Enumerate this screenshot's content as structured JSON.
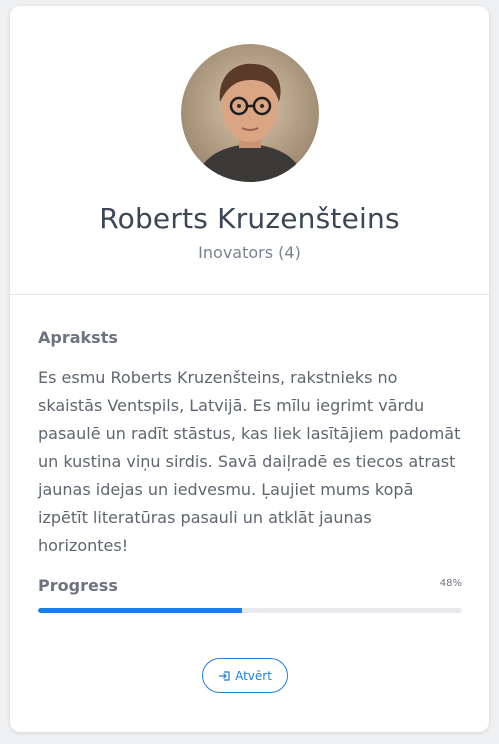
{
  "profile": {
    "name": "Roberts Kruzenšteins",
    "subtitle": "Inovators (4)",
    "avatar_icon": "person-photo"
  },
  "description": {
    "title": "Apraksts",
    "text": "Es esmu Roberts Kruzenšteins, rakstnieks no skaistās Ventspils, Latvijā. Es mīlu iegrimt vārdu pasaulē un radīt stāstus, kas liek lasītājiem padomāt un kustina viņu sirdis. Savā daiļradē es tiecos atrast jaunas idejas un iedvesmu. Ļaujiet mums kopā izpētīt literatūras pasauli un atklāt jaunas horizontes!"
  },
  "progress": {
    "title": "Progress",
    "value_label": "48%",
    "value": 0.48
  },
  "actions": {
    "open_label": "Atvērt",
    "open_icon": "sign-in-icon"
  },
  "colors": {
    "accent": "#1a7fe6",
    "name": "#3b4656",
    "muted": "#7a838f"
  }
}
